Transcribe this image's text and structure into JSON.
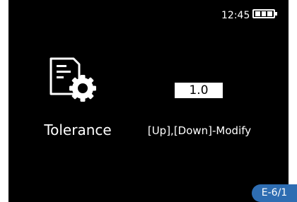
{
  "status": {
    "time": "12:45",
    "battery_icon": "battery-icon",
    "battery_level": 1.0
  },
  "setting": {
    "icon": "document-gear-icon",
    "label": "Tolerance",
    "value": "1.0"
  },
  "hint": "[Up],[Down]-Modify",
  "page_indicator": "E-6/1",
  "colors": {
    "screen_bg": "#000000",
    "text": "#ffffff",
    "badge": "#2e6db2"
  }
}
